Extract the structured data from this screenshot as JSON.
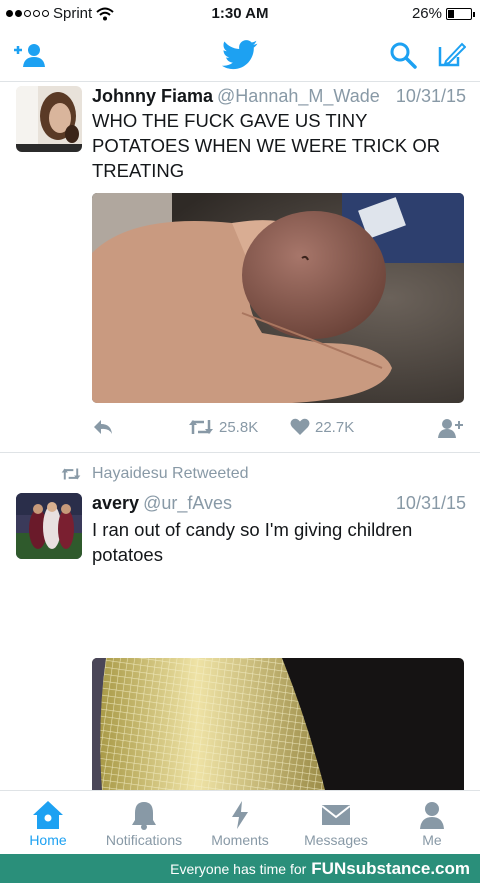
{
  "status_bar": {
    "carrier": "Sprint",
    "time": "1:30 AM",
    "battery": "26%",
    "battery_level": 0.26,
    "signal_bars": 2
  },
  "nav": {
    "accent": "#1da1f2",
    "icons": [
      "add-user-icon",
      "twitter-bird-icon",
      "search-icon",
      "compose-icon"
    ]
  },
  "tweets": [
    {
      "name": "Johnny Fiama",
      "handle": "@Hannah_M_Wade",
      "date": "10/31/15",
      "text": "WHO THE FUCK GAVE US TINY POTATOES WHEN WE WERE TRICK OR TREATING",
      "retweets": "25.8K",
      "likes": "22.7K"
    },
    {
      "retweeted_by": "Hayaidesu Retweeted",
      "name": "avery",
      "handle": "@ur_fAves",
      "date": "10/31/15",
      "text": "I ran out of candy so I'm giving children potatoes"
    }
  ],
  "tabbar": {
    "home": "Home",
    "notifications": "Notifications",
    "moments": "Moments",
    "messages": "Messages",
    "me": "Me"
  },
  "banner": {
    "text": "Everyone has time for",
    "brand": "FUNsubstance.com"
  }
}
